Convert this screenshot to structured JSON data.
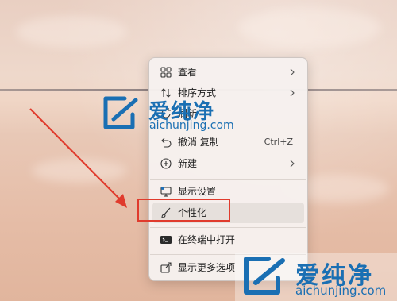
{
  "context_menu": {
    "items": [
      {
        "id": "view",
        "label": "查看",
        "icon": "grid-icon",
        "has_submenu": true
      },
      {
        "id": "sort",
        "label": "排序方式",
        "icon": "sort-icon",
        "has_submenu": true
      },
      {
        "id": "refresh",
        "label": "刷新",
        "icon": "refresh-icon",
        "has_submenu": false
      },
      {
        "id": "undo",
        "label": "撤消 复制",
        "icon": "undo-icon",
        "shortcut": "Ctrl+Z",
        "has_submenu": false
      },
      {
        "id": "new",
        "label": "新建",
        "icon": "plus-circle-icon",
        "has_submenu": true
      },
      {
        "id": "display",
        "label": "显示设置",
        "icon": "monitor-icon",
        "has_submenu": false
      },
      {
        "id": "personalize",
        "label": "个性化",
        "icon": "brush-icon",
        "has_submenu": false,
        "highlighted": true
      },
      {
        "id": "terminal",
        "label": "在终端中打开",
        "icon": "terminal-icon",
        "has_submenu": false
      },
      {
        "id": "more",
        "label": "显示更多选项",
        "icon": "share-icon",
        "has_submenu": false
      }
    ]
  },
  "watermark": {
    "brand": "爱纯净",
    "url": "aichunjing.com",
    "logo_color": "#1a6fb3",
    "text_color": "#1a6fb3"
  },
  "annotation": {
    "highlight_color": "#e03b2d",
    "target": "个性化"
  }
}
